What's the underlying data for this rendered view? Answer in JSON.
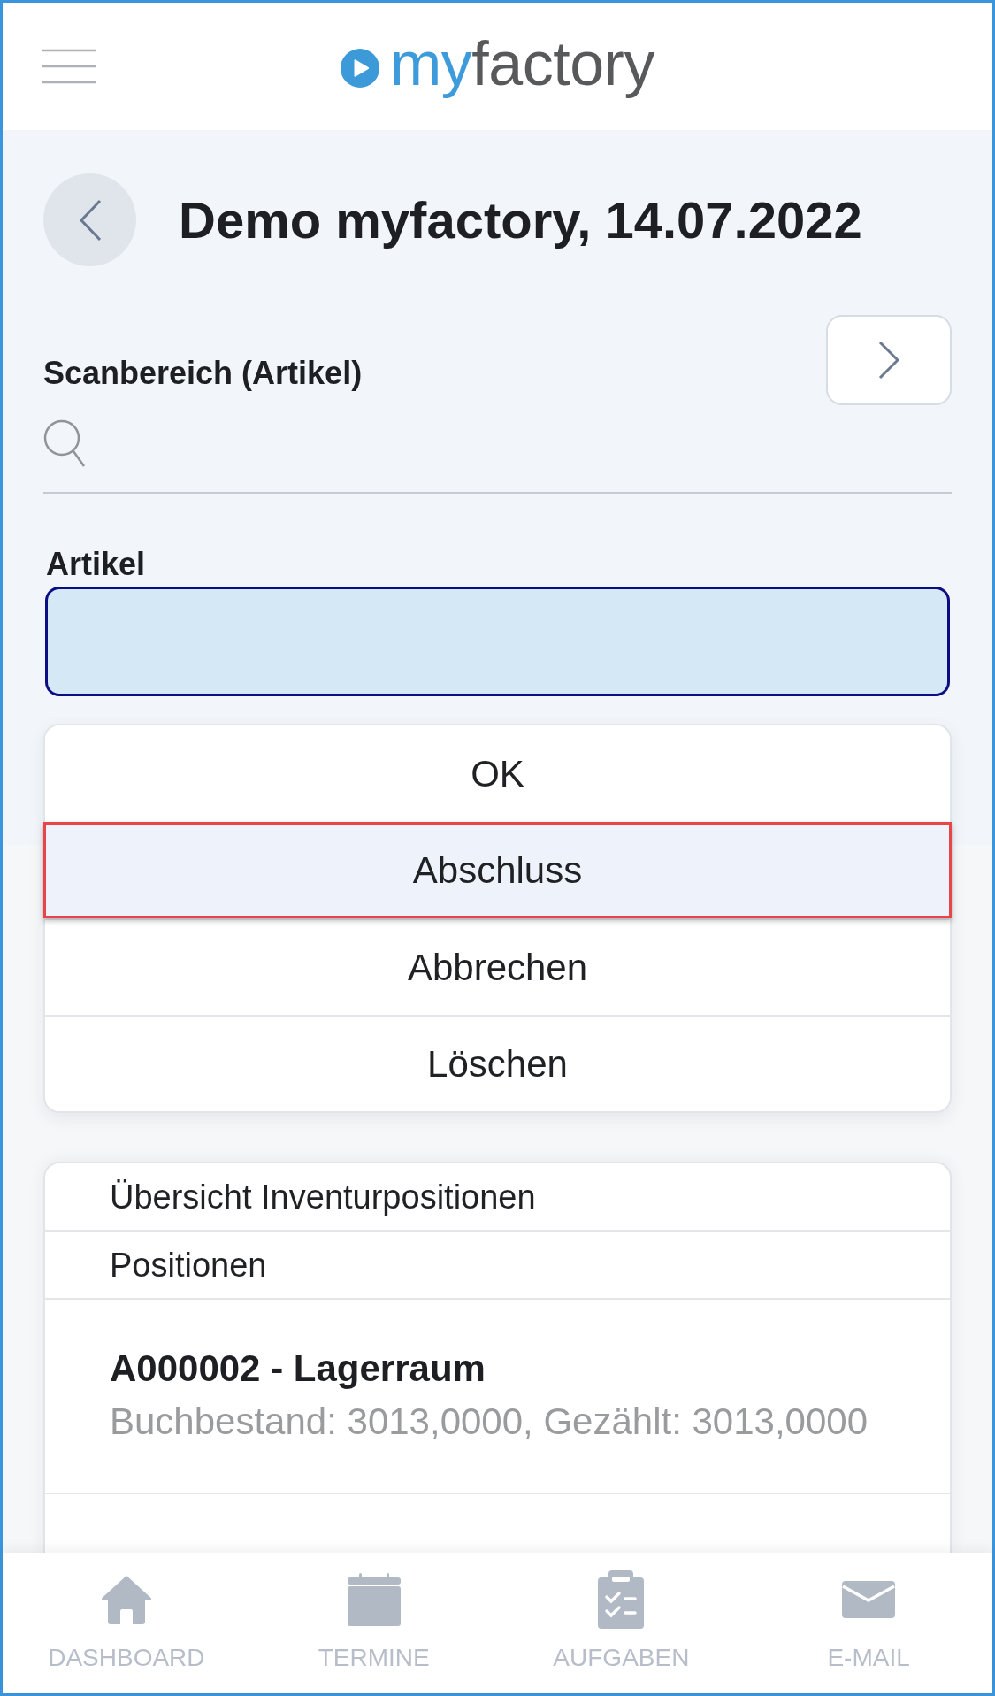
{
  "header": {
    "logo": {
      "accent": "my",
      "rest": "factory"
    }
  },
  "page": {
    "title": "Demo myfactory, 14.07.2022"
  },
  "scan": {
    "label": "Scanbereich (Artikel)"
  },
  "article": {
    "label": "Artikel",
    "focused": true
  },
  "actions": [
    {
      "label": "OK",
      "highlighted": false
    },
    {
      "label": "Abschluss",
      "highlighted": true
    },
    {
      "label": "Abbrechen",
      "highlighted": false
    },
    {
      "label": "Löschen",
      "highlighted": false
    }
  ],
  "list": {
    "headings": [
      "Übersicht Inventurpositionen",
      "Positionen"
    ],
    "items": [
      {
        "title": "A000002 - Lagerraum",
        "detail": "Buchbestand: 3013,0000, Gezählt: 3013,0000"
      }
    ]
  },
  "nav": [
    {
      "label": "DASHBOARD",
      "selected": false
    },
    {
      "label": "TERMINE",
      "selected": false
    },
    {
      "label": "AUFGABEN",
      "selected": false
    },
    {
      "label": "E-MAIL",
      "selected": false
    }
  ]
}
